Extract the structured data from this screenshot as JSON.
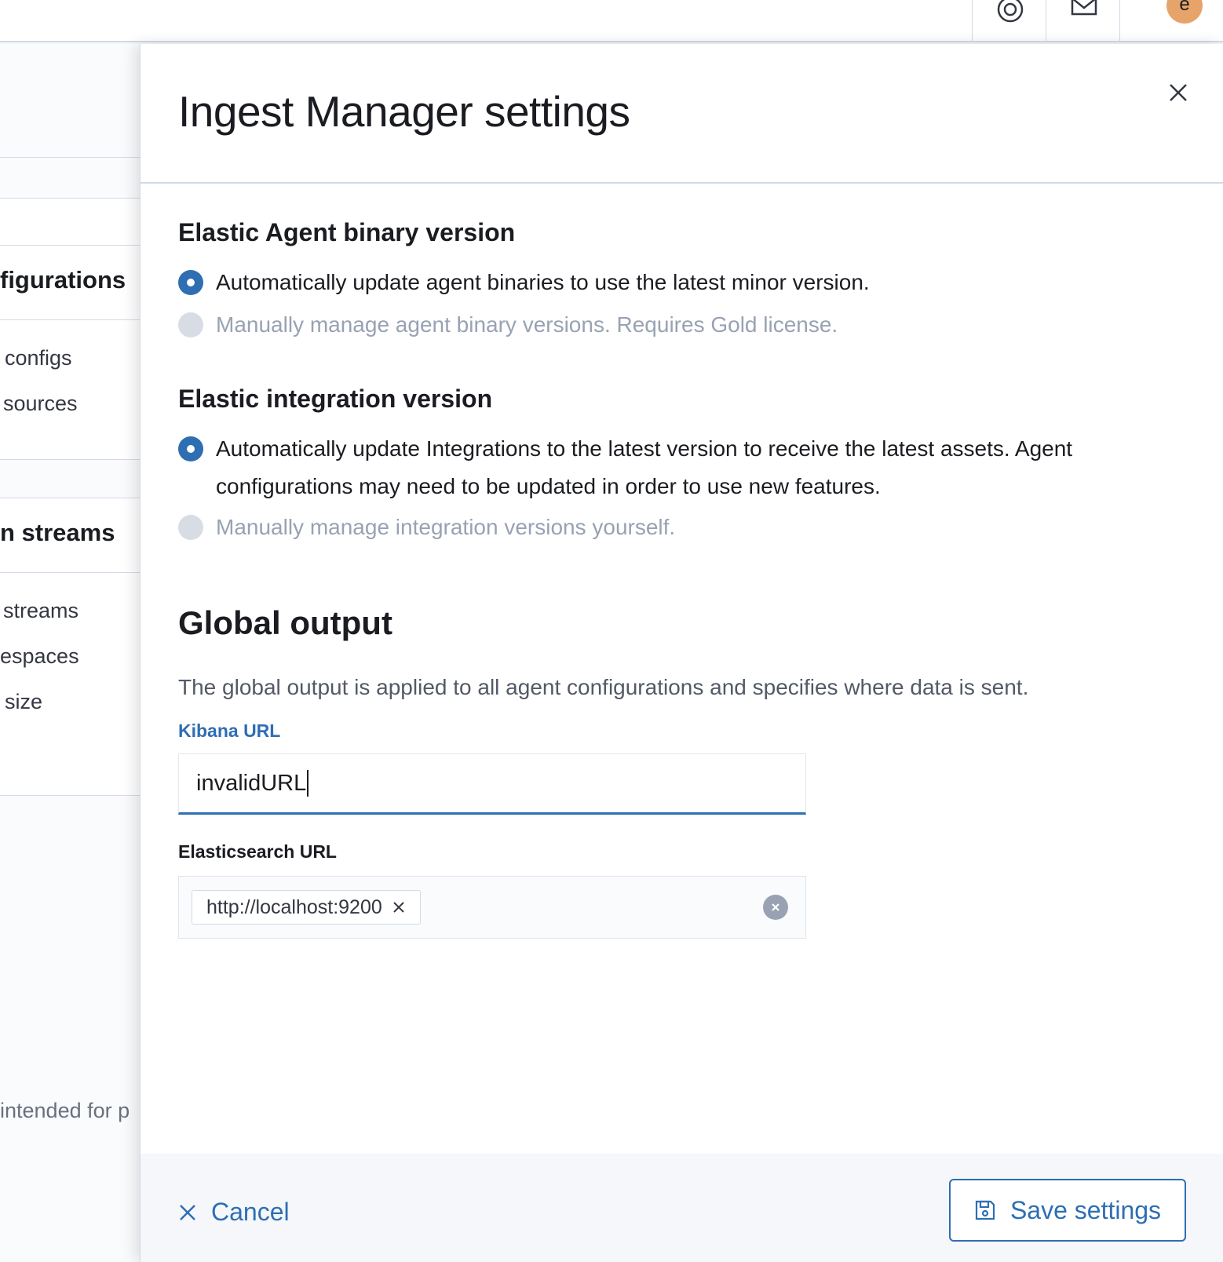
{
  "header": {
    "avatar_initial": "e",
    "help_icon": "help-icon",
    "mail_icon": "mail-icon"
  },
  "background": {
    "section1_title": "figurations",
    "section1_items": [
      "configs",
      "sources"
    ],
    "section2_title": "n streams",
    "section2_items": [
      "streams",
      "espaces",
      "size"
    ],
    "footer_text": "intended for p"
  },
  "flyout": {
    "title": "Ingest Manager settings",
    "agent_binary": {
      "title": "Elastic Agent binary version",
      "options": [
        {
          "label": "Automatically update agent binaries to use the latest minor version.",
          "selected": true,
          "disabled": false
        },
        {
          "label": "Manually manage agent binary versions. Requires Gold license.",
          "selected": false,
          "disabled": true
        }
      ]
    },
    "integration": {
      "title": "Elastic integration version",
      "options": [
        {
          "label": "Automatically update Integrations to the latest version to receive the latest assets. Agent configurations may need to be updated in order to use new features.",
          "selected": true,
          "disabled": false
        },
        {
          "label": "Manually manage integration versions yourself.",
          "selected": false,
          "disabled": true
        }
      ]
    },
    "global_output": {
      "title": "Global output",
      "description": "The global output is applied to all agent configurations and specifies where data is sent.",
      "kibana_label": "Kibana URL",
      "kibana_value": "invalidURL",
      "elasticsearch_label": "Elasticsearch URL",
      "elasticsearch_values": [
        "http://localhost:9200"
      ]
    },
    "footer": {
      "cancel_label": "Cancel",
      "save_label": "Save settings"
    }
  },
  "colors": {
    "accent": "#2e6eb3",
    "avatar": "#e7a46a",
    "disabled_text": "#98a2b3"
  }
}
